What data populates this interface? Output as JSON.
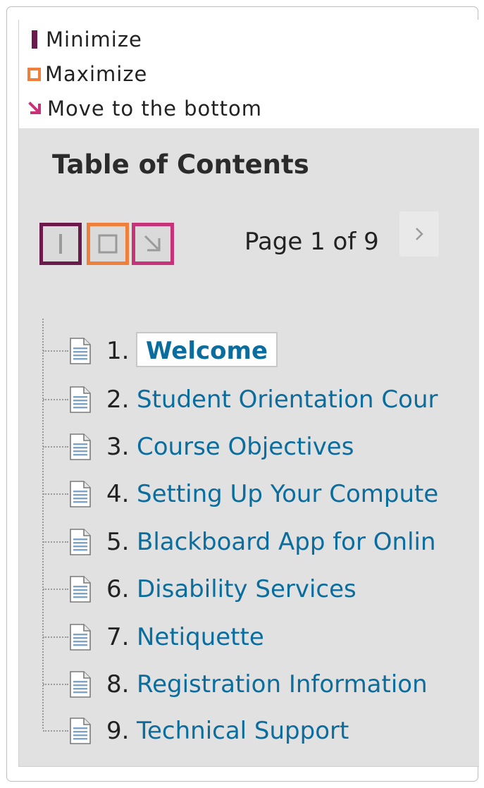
{
  "legend": {
    "items": [
      {
        "label": "Minimize",
        "icon": "minimize-icon",
        "color": "#6b1b4b"
      },
      {
        "label": "Maximize",
        "icon": "maximize-icon",
        "color": "#f07f3c"
      },
      {
        "label": "Move to the bottom",
        "icon": "move-to-bottom-icon",
        "color": "#c83279"
      }
    ]
  },
  "toc": {
    "title": "Table of Contents",
    "pagination": {
      "label": "Page 1 of 9",
      "next_icon": "chevron-right-icon"
    },
    "items": [
      {
        "number": "1.",
        "label": "Welcome",
        "active": true
      },
      {
        "number": "2.",
        "label": "Student Orientation Cour"
      },
      {
        "number": "3.",
        "label": "Course Objectives"
      },
      {
        "number": "4.",
        "label": "Setting Up Your Compute"
      },
      {
        "number": "5.",
        "label": "Blackboard App for Onlin"
      },
      {
        "number": "6.",
        "label": "Disability Services"
      },
      {
        "number": "7.",
        "label": "Netiquette"
      },
      {
        "number": "8.",
        "label": "Registration Information"
      },
      {
        "number": "9.",
        "label": "Technical Support"
      }
    ]
  },
  "colors": {
    "link": "#0a6d9e",
    "panel_bg": "#e1e1e1",
    "minimize": "#6b1b4b",
    "maximize": "#f07f3c",
    "move_bottom": "#c83279"
  }
}
